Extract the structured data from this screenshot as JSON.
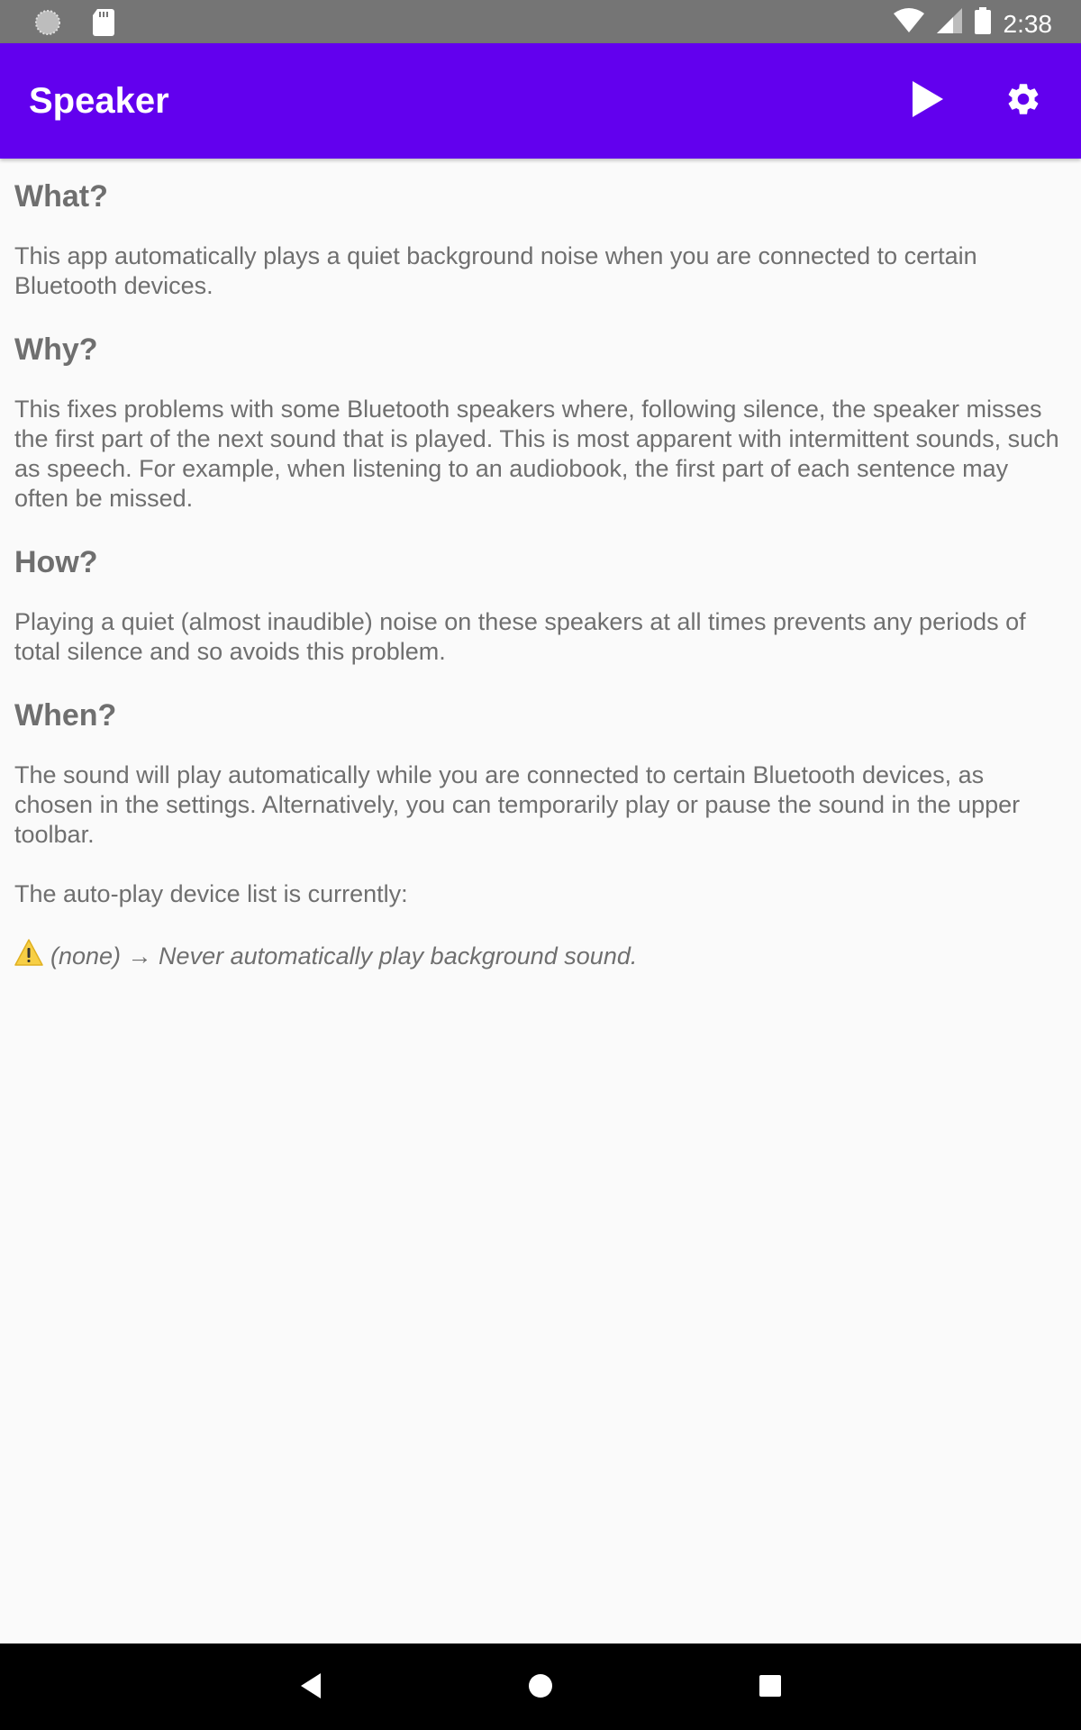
{
  "status_bar": {
    "time": "2:38",
    "left_icons": [
      "loading-spinner-icon",
      "sd-card-icon"
    ],
    "right_icons": [
      "wifi-icon",
      "cellular-signal-icon",
      "battery-icon"
    ]
  },
  "app_bar": {
    "title": "Speaker",
    "actions": [
      "play-icon",
      "settings-gear-icon"
    ],
    "color": "#6200ee"
  },
  "sections": [
    {
      "heading": "What?",
      "paragraphs": [
        "This app automatically plays a quiet background noise when you are connected to certain Bluetooth devices."
      ]
    },
    {
      "heading": "Why?",
      "paragraphs": [
        "This fixes problems with some Bluetooth speakers where, following silence, the speaker misses the first part of the next sound that is played. This is most apparent with intermittent sounds, such as speech. For example, when listening to an audiobook, the first part of each sentence may often be missed."
      ]
    },
    {
      "heading": "How?",
      "paragraphs": [
        "Playing a quiet (almost inaudible) noise on these speakers at all times prevents any periods of total silence and so avoids this problem."
      ]
    },
    {
      "heading": "When?",
      "paragraphs": [
        "The sound will play automatically while you are connected to certain Bluetooth devices, as chosen in the settings. Alternatively, you can temporarily play or pause the sound in the upper toolbar.",
        "The auto-play device list is currently:"
      ]
    }
  ],
  "device_list": {
    "icon": "warning-icon",
    "text": "(none) → Never automatically play background sound."
  },
  "nav_bar": {
    "buttons": [
      "back-icon",
      "home-icon",
      "recents-icon"
    ]
  }
}
